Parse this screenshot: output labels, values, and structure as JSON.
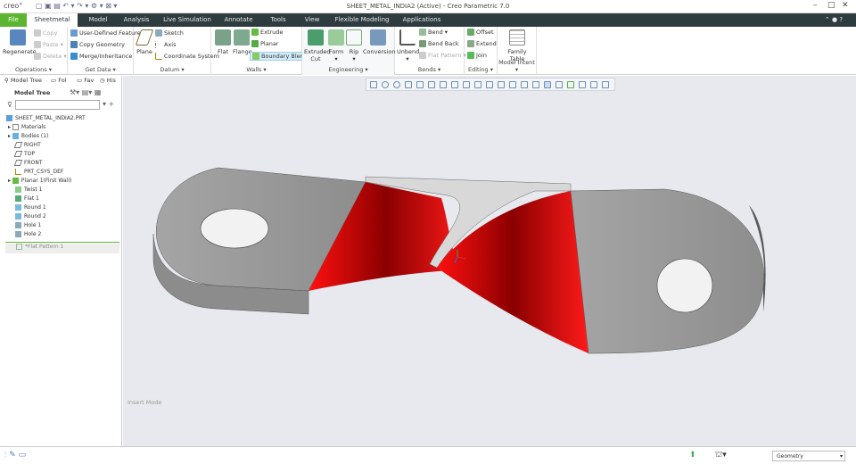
{
  "window": {
    "title": "SHEET_METAL_INDIA2 (Active) - Creo Parametric 7.0",
    "logo": "creo°"
  },
  "tabs": [
    "File",
    "Sheetmetal",
    "Model",
    "Analysis",
    "Live Simulation",
    "Annotate",
    "Tools",
    "View",
    "Flexible Modeling",
    "Applications"
  ],
  "ribbon": {
    "operations": {
      "label": "Operations ▾",
      "regenerate": "Regenerate",
      "copy": "Copy",
      "paste": "Paste ▾",
      "delete": "Delete ▾"
    },
    "get_data": {
      "label": "Get Data ▾",
      "udf": "User-Defined Feature",
      "copy_geom": "Copy Geometry",
      "merge": "Merge/Inheritance"
    },
    "datum": {
      "label": "Datum ▾",
      "plane": "Plane",
      "sketch": "Sketch",
      "axis": "Axis",
      "csys": "Coordinate System"
    },
    "walls": {
      "label": "Walls ▾",
      "flat": "Flat",
      "flange": "Flange",
      "extrude": "Extrude",
      "planar": "Planar",
      "boundary_blend": "Boundary Blend"
    },
    "engineering": {
      "label": "Engineering ▾",
      "extruded_cut_1": "Extruded",
      "extruded_cut_2": "Cut",
      "form": "Form",
      "rip": "Rip",
      "conversion": "Conversion"
    },
    "bends": {
      "label": "Bends ▾",
      "unbend": "Unbend",
      "bend": "Bend ▾",
      "bend_back": "Bend Back",
      "flat_pattern": "Flat Pattern ▾"
    },
    "editing": {
      "label": "Editing ▾",
      "offset": "Offset",
      "extend": "Extend",
      "join": "Join"
    },
    "model_intent": {
      "label": "Model Intent ▾",
      "family_1": "Family",
      "family_2": "Table"
    }
  },
  "left_panel": {
    "tabs": [
      "Model Tree",
      "Fol",
      "Fav",
      "His"
    ],
    "tree_header": "Model Tree",
    "search_placeholder": "",
    "items": [
      "SHEET_METAL_INDIA2.PRT",
      "Materials",
      "Bodies (1)",
      "RIGHT",
      "TOP",
      "FRONT",
      "PRT_CSYS_DEF",
      "Planar 1(First Wall)",
      "Twist 1",
      "Flat 1",
      "Round 1",
      "Round 2",
      "Hole 1",
      "Hole 2"
    ],
    "insert_item": "*Flat Pattern 1"
  },
  "viewport": {
    "mode_text": "Insert Mode"
  },
  "status": {
    "filter": "Geometry"
  },
  "colors": {
    "accent": "#5cb531",
    "tabbar": "#2e3b3f",
    "highlight": "#e00000"
  }
}
